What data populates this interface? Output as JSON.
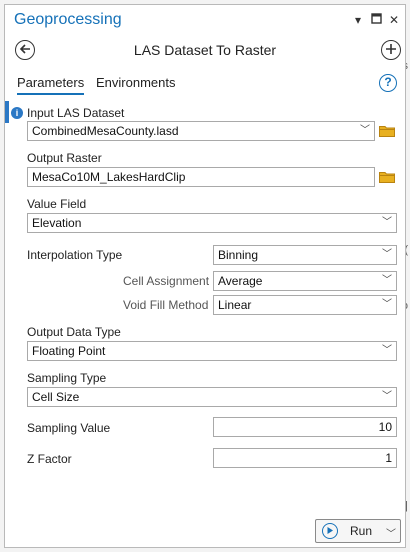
{
  "background": {
    "right_marks": [
      "ls",
      "(",
      "o",
      "|"
    ]
  },
  "window": {
    "title": "Geoprocessing"
  },
  "tool": {
    "title": "LAS Dataset To Raster"
  },
  "tabs": {
    "parameters": "Parameters",
    "environments": "Environments"
  },
  "params": {
    "input_las": {
      "label": "Input LAS Dataset",
      "value": "CombinedMesaCounty.lasd"
    },
    "output_raster": {
      "label": "Output Raster",
      "value": "MesaCo10M_LakesHardClip"
    },
    "value_field": {
      "label": "Value Field",
      "value": "Elevation"
    },
    "interp_type": {
      "label": "Interpolation Type",
      "value": "Binning"
    },
    "cell_assignment": {
      "label": "Cell Assignment",
      "value": "Average"
    },
    "void_fill": {
      "label": "Void Fill Method",
      "value": "Linear"
    },
    "output_dtype": {
      "label": "Output Data Type",
      "value": "Floating Point"
    },
    "sampling_type": {
      "label": "Sampling Type",
      "value": "Cell Size"
    },
    "sampling_value": {
      "label": "Sampling Value",
      "value": "10"
    },
    "z_factor": {
      "label": "Z Factor",
      "value": "1"
    }
  },
  "run": {
    "label": "Run"
  },
  "colors": {
    "accent": "#1571b8",
    "folder": "#e8b020"
  }
}
